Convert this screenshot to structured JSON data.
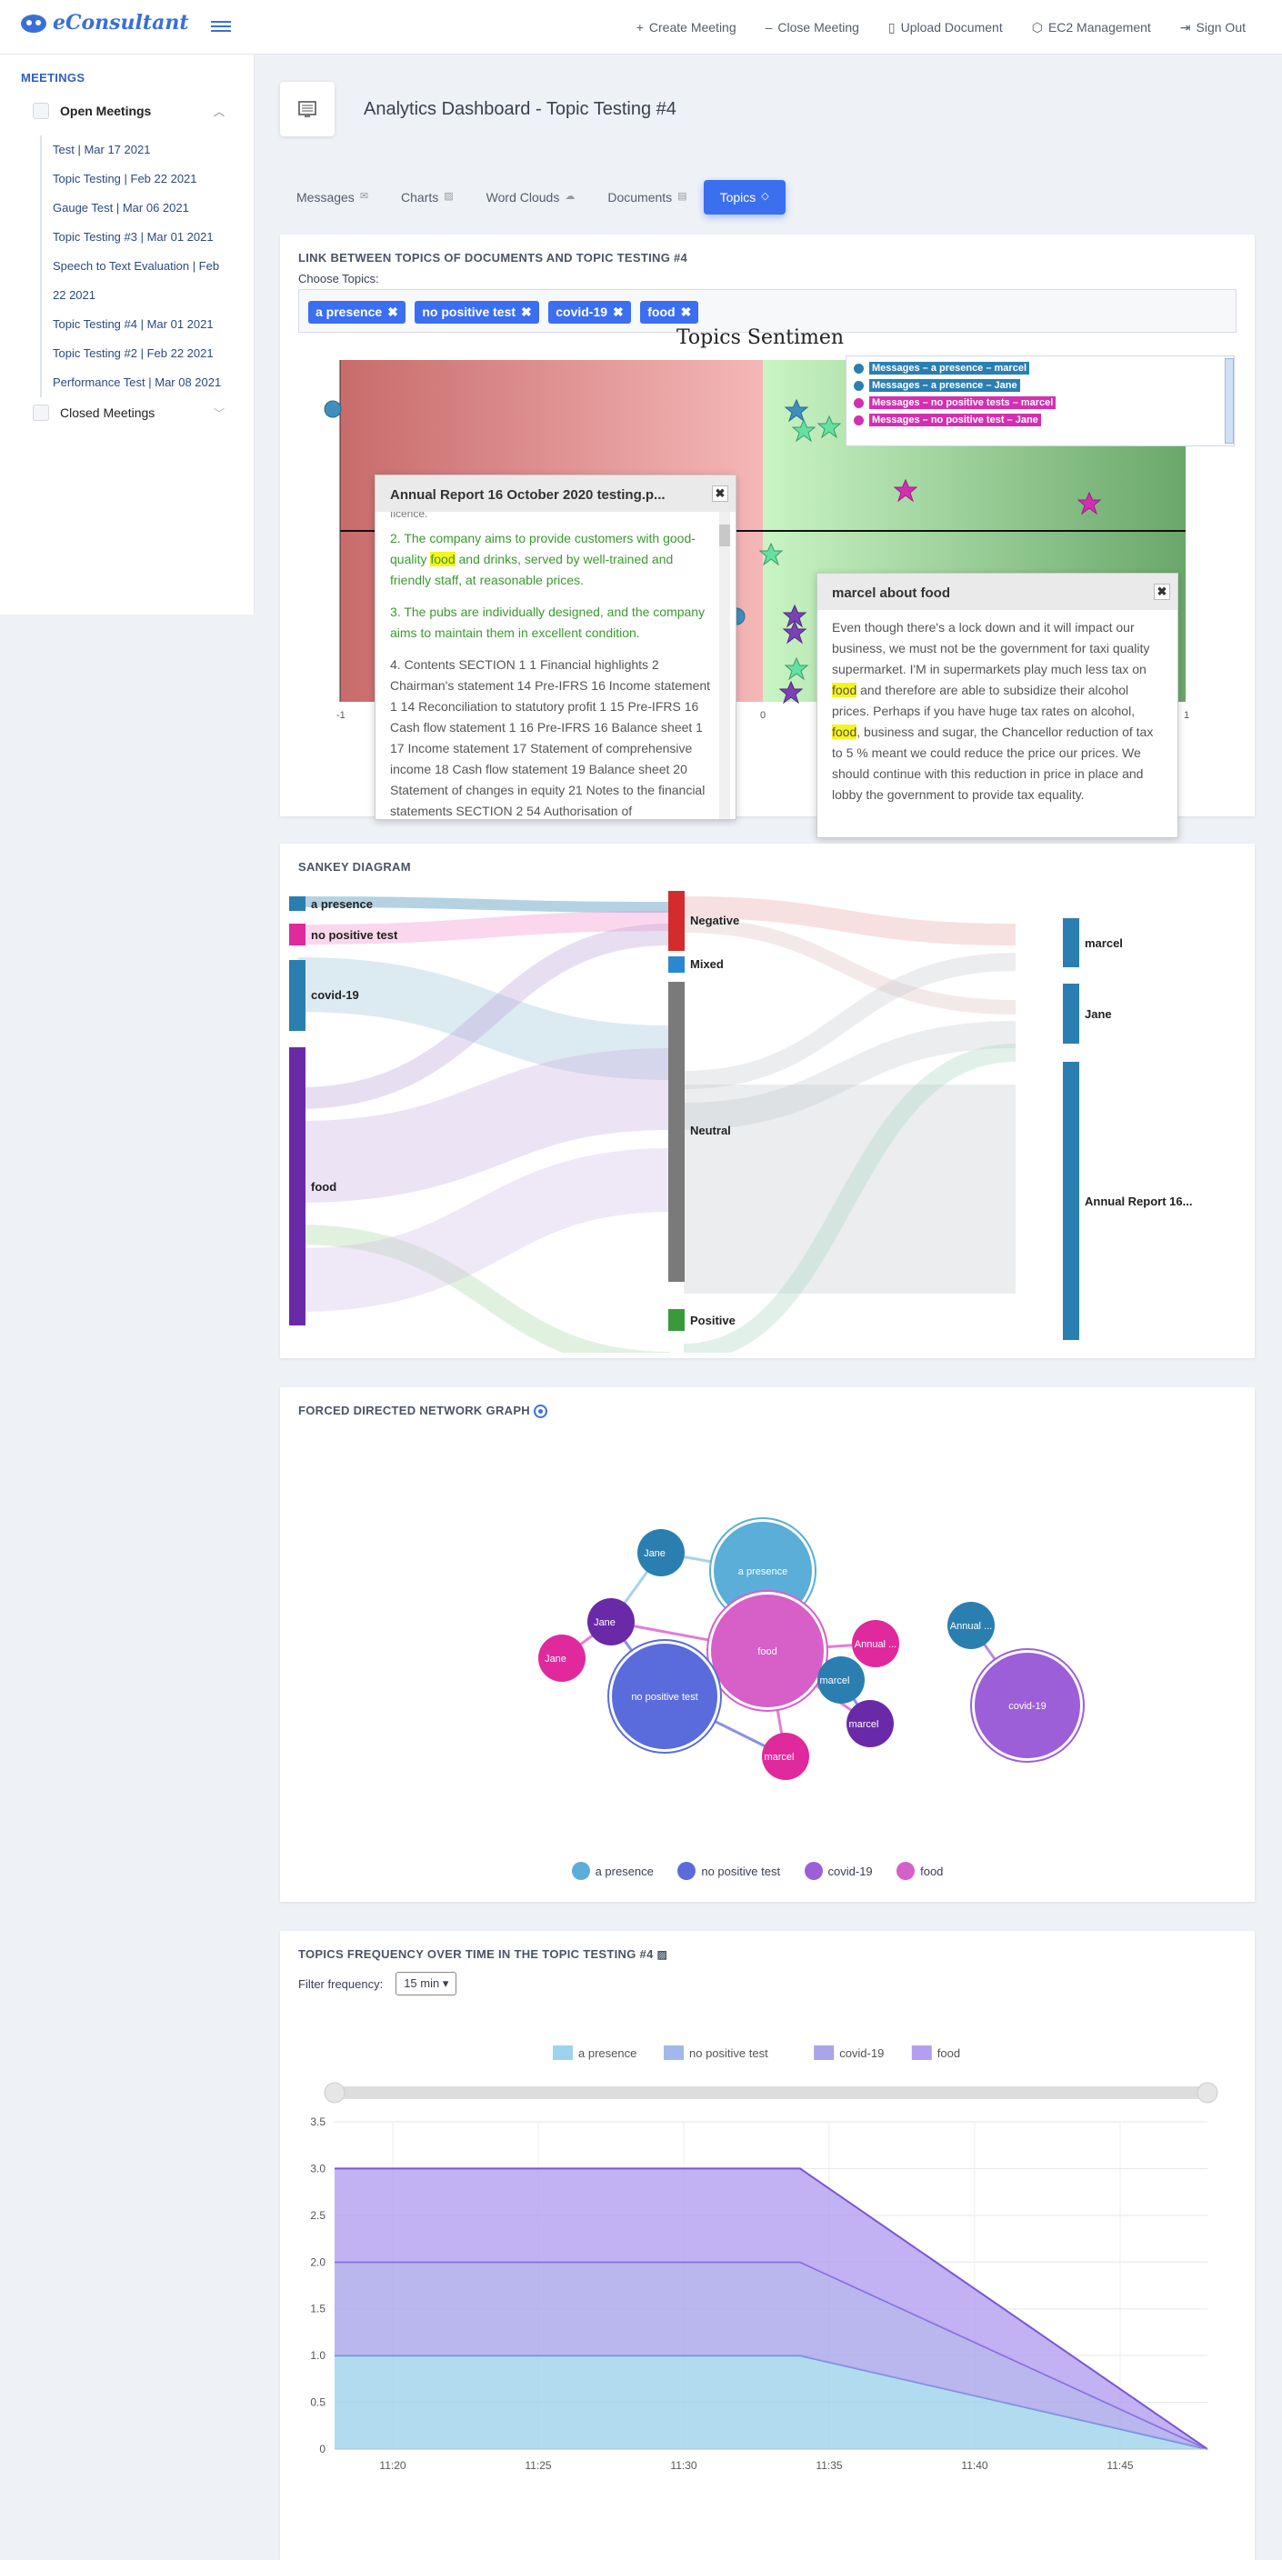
{
  "app": {
    "name": "eConsultant"
  },
  "topnav": [
    {
      "label": "Create Meeting",
      "icon": "plus-icon"
    },
    {
      "label": "Close Meeting",
      "icon": "minus-icon"
    },
    {
      "label": "Upload Document",
      "icon": "document-icon"
    },
    {
      "label": "EC2 Management",
      "icon": "cube-icon"
    },
    {
      "label": "Sign Out",
      "icon": "sign-out-icon"
    }
  ],
  "sidebar": {
    "title": "MEETINGS",
    "open_label": "Open Meetings",
    "closed_label": "Closed Meetings",
    "meetings": [
      "Test | Mar 17 2021",
      "Topic Testing | Feb 22 2021",
      "Gauge Test | Mar 06 2021",
      "Topic Testing #3 | Mar 01 2021",
      "Speech to Text Evaluation | Feb",
      "22 2021",
      "Topic Testing #4 | Mar 01 2021",
      "Topic Testing #2 | Feb 22 2021",
      "Performance Test | Mar 08 2021"
    ]
  },
  "page": {
    "title": "Analytics Dashboard - Topic Testing #4"
  },
  "tabs": [
    "Messages",
    "Charts",
    "Word Clouds",
    "Documents",
    "Topics"
  ],
  "topics_card": {
    "title": "LINK BETWEEN TOPICS OF DOCUMENTS AND TOPIC TESTING #4",
    "choose_label": "Choose Topics:",
    "chips": [
      "a presence",
      "no positive test",
      "covid-19",
      "food"
    ],
    "chart_title": "Topics Sentimen",
    "legend": [
      "Messages – a presence – marcel",
      "Messages – a presence – Jane",
      "Messages – no positive tests – marcel",
      "Messages – no positive test – Jane"
    ],
    "axis": {
      "x_neg": "-1",
      "x_zero": "0",
      "x_pos": "1"
    },
    "popup1": {
      "title": "Annual Report 16 October 2020 testing.p...",
      "cut": "Iicence.",
      "p1a": "2. The company aims to provide customers with good-quality ",
      "p1b": "food",
      "p1c": " and drinks, served by well-trained and friendly staff, at reasonable prices.",
      "p2": "3. The pubs are individually designed, and the company aims to maintain them in excellent condition.",
      "p3": "4. Contents SECTION 1 1 Financial highlights 2 Chairman's statement 14 Pre-IFRS 16 Income statement 1 14 Reconciliation to statutory profit 1 15 Pre-IFRS 16 Cash flow statement 1 16 Pre-IFRS 16 Balance sheet 1 17 Income statement 17 Statement of comprehensive income 18 Cash flow statement 19 Balance sheet 20 Statement of changes in equity 21 Notes to the financial statements SECTION 2 54 Authorisation of"
    },
    "popup2": {
      "title": "marcel about food",
      "a": "Even though there's a lock down and it will impact our business, we must not be the government for taxi quality supermarket. I'M in supermarkets play much less tax on ",
      "b": "food",
      "c": " and therefore are able to subsidize their alcohol prices. Perhaps if you have huge tax rates on alcohol, ",
      "d": "food",
      "e": ", business and sugar, the Chancellor reduction of tax to 5 % meant we could reduce the price our prices. We should continue with this reduction in price in place and lobby the government to provide tax equality."
    }
  },
  "sankey": {
    "title": "SANKEY DIAGRAM",
    "sources": [
      "a presence",
      "no positive test",
      "covid-19",
      "food"
    ],
    "mids": [
      "Negative",
      "Mixed",
      "Neutral",
      "Positive"
    ],
    "targets": [
      "marcel",
      "Jane",
      "Annual Report 16..."
    ]
  },
  "network": {
    "title": "FORCED DIRECTED NETWORK GRAPH",
    "nodes": {
      "presence": "a presence",
      "food": "food",
      "npt": "no positive test",
      "covid": "covid-19",
      "jane": "Jane",
      "marcel": "marcel",
      "annual": "Annual ..."
    },
    "legend": [
      "a presence",
      "no positive test",
      "covid-19",
      "food"
    ],
    "colors": {
      "presence": "#5aaed8",
      "npt": "#5a6cdc",
      "covid": "#9d5fd8",
      "food": "#d75fc8"
    }
  },
  "freq": {
    "title": "TOPICS FREQUENCY OVER TIME IN THE TOPIC TESTING #4",
    "filter_label": "Filter frequency:",
    "filter_value": "15 min"
  },
  "chart_data": {
    "type": "area",
    "x": [
      "11:18",
      "11:34",
      "11:48"
    ],
    "xticks": [
      "11:20",
      "11:25",
      "11:30",
      "11:35",
      "11:40",
      "11:45"
    ],
    "yticks": [
      "0",
      "0.5",
      "1.0",
      "1.5",
      "2.0",
      "2.5",
      "3.0",
      "3.5"
    ],
    "ylim": [
      0,
      3.5
    ],
    "stacked": true,
    "series": [
      {
        "name": "a presence",
        "values": [
          1,
          1,
          0
        ],
        "color": "#9dd3ec"
      },
      {
        "name": "no positive test",
        "values": [
          0,
          0,
          0
        ],
        "color": "#a3b8ea"
      },
      {
        "name": "covid-19",
        "values": [
          1,
          1,
          0
        ],
        "color": "#a8a5e8"
      },
      {
        "name": "food",
        "values": [
          1,
          1,
          0
        ],
        "color": "#b39ff0"
      }
    ]
  }
}
